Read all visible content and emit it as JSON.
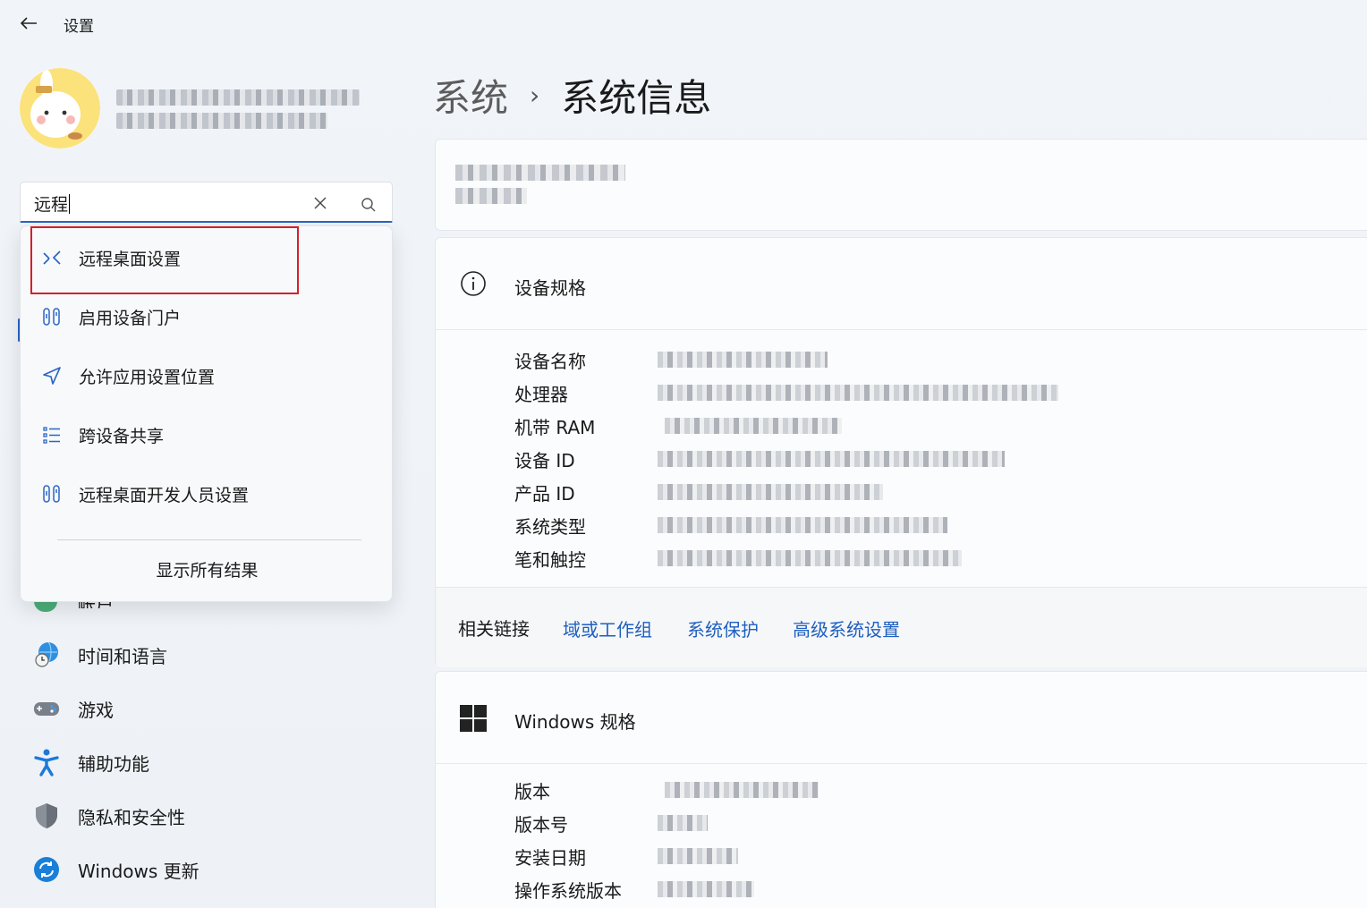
{
  "window": {
    "title": "设置"
  },
  "search": {
    "value": "远程"
  },
  "search_results": [
    {
      "label": "远程桌面设置",
      "icon": "remote-desktop-icon"
    },
    {
      "label": "启用设备门户",
      "icon": "developer-tools-icon"
    },
    {
      "label": "允许应用设置位置",
      "icon": "location-icon"
    },
    {
      "label": "跨设备共享",
      "icon": "list-icon"
    },
    {
      "label": "远程桌面开发人员设置",
      "icon": "developer-tools-icon"
    }
  ],
  "search_show_all": "显示所有结果",
  "sidebar": {
    "partial_item": "帐户",
    "items": [
      {
        "label": "时间和语言",
        "icon": "globe-clock-icon"
      },
      {
        "label": "游戏",
        "icon": "gamepad-icon"
      },
      {
        "label": "辅助功能",
        "icon": "accessibility-icon"
      },
      {
        "label": "隐私和安全性",
        "icon": "shield-icon"
      },
      {
        "label": "Windows 更新",
        "icon": "update-icon"
      }
    ]
  },
  "breadcrumb": {
    "parent": "系统",
    "separator": "›",
    "current": "系统信息"
  },
  "device_specs": {
    "title": "设备规格",
    "rows": [
      "设备名称",
      "处理器",
      "机带 RAM",
      "设备 ID",
      "产品 ID",
      "系统类型",
      "笔和触控"
    ]
  },
  "related_links": {
    "label": "相关链接",
    "links": [
      "域或工作组",
      "系统保护",
      "高级系统设置"
    ]
  },
  "windows_specs": {
    "title": "Windows 规格",
    "rows": [
      "版本",
      "版本号",
      "安装日期",
      "操作系统版本"
    ]
  },
  "colors": {
    "accent": "#2a64c4",
    "link": "#1f5fbf",
    "highlight": "#d4202a"
  }
}
